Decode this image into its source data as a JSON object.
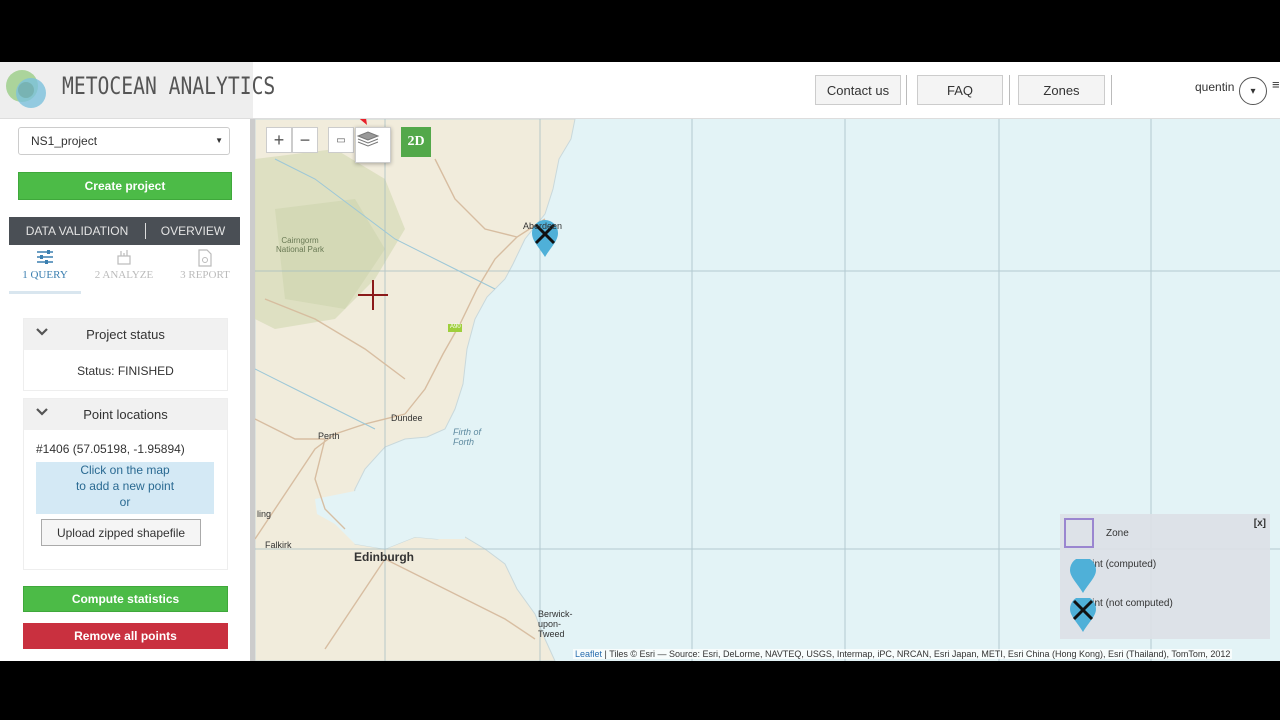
{
  "header": {
    "logo_text": "METOCEAN ANALYTICS",
    "buttons": [
      "Contact us",
      "FAQ",
      "Zones"
    ],
    "user_name": "quentin"
  },
  "sidebar": {
    "project_selected": "NS1_project",
    "create_project_label": "Create project",
    "tabs": [
      "DATA VALIDATION",
      "OVERVIEW"
    ],
    "steps": [
      {
        "label": "1 QUERY",
        "icon": "sliders-icon"
      },
      {
        "label": "2 ANALYZE",
        "icon": "chart-icon"
      },
      {
        "label": "3 REPORT",
        "icon": "document-icon"
      }
    ],
    "project_status": {
      "title": "Project status",
      "status": "Status: FINISHED"
    },
    "point_locations": {
      "title": "Point locations",
      "item": "#1406 (57.05198, -1.95894)",
      "hint_lines": [
        "Click on the map",
        "to add a new point",
        "or"
      ],
      "upload_label": "Upload zipped shapefile"
    },
    "compute_label": "Compute statistics",
    "remove_label": "Remove all points"
  },
  "map": {
    "zoom_in": "+",
    "zoom_out": "−",
    "mode_2d": "2D",
    "places": {
      "aberdeen": "Aberdeen",
      "cairngorm": "Cairngorm National Park",
      "a90": "A90",
      "dundee": "Dundee",
      "perth": "Perth",
      "firth": "Firth of Forth",
      "stirling": "ling",
      "falkirk": "Falkirk",
      "edinburgh": "Edinburgh",
      "berwick": "Berwick-upon-Tweed"
    },
    "legend": {
      "close": "[x]",
      "zone": "Zone",
      "computed": "Point (computed)",
      "not_computed": "Point (not computed)"
    },
    "attribution_link": "Leaflet",
    "attribution_text": " | Tiles © Esri — Source: Esri, DeLorme, NAVTEQ, USGS, Intermap, iPC, NRCAN, Esri Japan, METI, Esri China (Hong Kong), Esri (Thailand), TomTom, 2012",
    "colors": {
      "sea": "#e3f3f6",
      "land": "#f1ecdc",
      "marker": "#4fb0d8",
      "annotation_arrow": "#e8202a"
    }
  }
}
